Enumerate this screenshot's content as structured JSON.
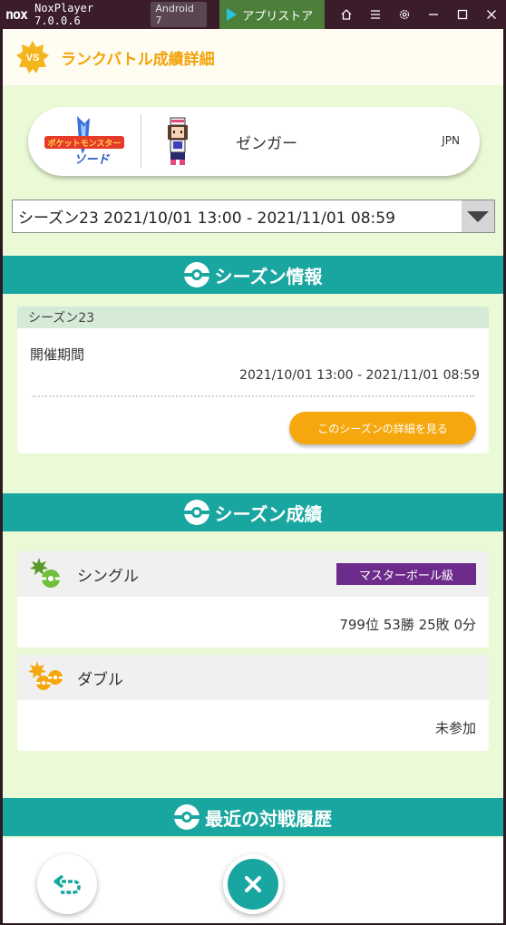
{
  "window": {
    "logo": "nox",
    "title": "NoxPlayer 7.0.0.6",
    "android": "Android 7",
    "appstore": "アプリストア",
    "icons": [
      "home-icon",
      "menu-icon",
      "gear-icon",
      "minimize-icon",
      "maximize-icon",
      "close-icon"
    ]
  },
  "header": {
    "badge": "VS",
    "title": "ランクバトル成績詳細"
  },
  "player": {
    "game_logo": "ポケットモンスター ソード",
    "name": "ゼンガー",
    "region": "JPN"
  },
  "season_select": {
    "value": "シーズン23 2021/10/01 13:00 - 2021/11/01 08:59"
  },
  "sections": {
    "season_info": "シーズン情報",
    "season_results": "シーズン成績",
    "recent_battles": "最近の対戦履歴"
  },
  "season_info": {
    "season_name": "シーズン23",
    "period_label": "開催期間",
    "period_value": "2021/10/01 13:00 - 2021/11/01 08:59",
    "detail_button": "このシーズンの詳細を見る"
  },
  "results": {
    "single": {
      "title": "シングル",
      "rank": "マスターボール級",
      "value": "799位 53勝 25敗 0分"
    },
    "double": {
      "title": "ダブル",
      "value": "未参加"
    }
  },
  "colors": {
    "accent": "#f2a30a",
    "teal": "#1aa6a0",
    "master_ball": "#6d2c8c",
    "background": "#eaf9d6"
  }
}
